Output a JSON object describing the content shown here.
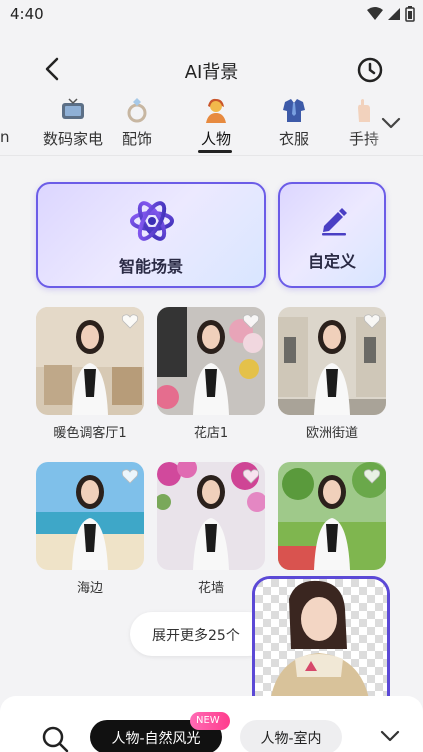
{
  "status": {
    "time": "4:40"
  },
  "header": {
    "title": "AI背景",
    "back_icon": "chevron-left-icon",
    "history_icon": "clock-icon"
  },
  "tabs": [
    {
      "label": "数码家电",
      "icon": "tv-icon"
    },
    {
      "label": "配饰",
      "icon": "ring-icon"
    },
    {
      "label": "人物",
      "icon": "person-icon",
      "active": true
    },
    {
      "label": "衣服",
      "icon": "shirt-icon"
    },
    {
      "label": "手持",
      "icon": "hand-icon"
    }
  ],
  "tabs_more_icon": "chevron-down-icon",
  "smart_card": {
    "label": "智能场景",
    "icon": "atom-icon"
  },
  "custom_card": {
    "label": "自定义",
    "icon": "pencil-icon"
  },
  "scenes": [
    {
      "label": "暖色调客厅1"
    },
    {
      "label": "花店1"
    },
    {
      "label": "欧洲街道"
    },
    {
      "label": "海边"
    },
    {
      "label": "花墙"
    },
    {
      "label": ""
    }
  ],
  "expand_button": {
    "label": "展开更多25个"
  },
  "bottom_bar": {
    "search_icon": "search-icon",
    "chips": [
      {
        "label": "人物-自然风光",
        "active": true
      },
      {
        "label": "人物-室内",
        "active": false
      }
    ],
    "new_badge": "NEW",
    "expand_icon": "chevron-down-icon"
  },
  "colors": {
    "accent": "#5b49d6",
    "card_border": "#6b5ce7"
  }
}
